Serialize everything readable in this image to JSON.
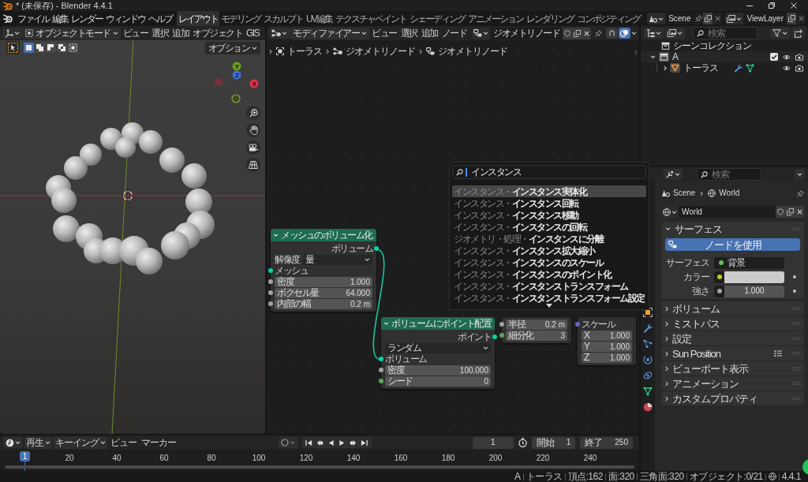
{
  "title_bar": {
    "title": "* (未保存) - Blender 4.4.1"
  },
  "top_bar": {
    "menus": [
      "ファイル",
      "編集",
      "レンダー",
      "ウィンドウ",
      "ヘルプ"
    ],
    "workspaces": [
      {
        "label": "レイアウト",
        "selected": true
      },
      {
        "label": "モデリング",
        "selected": false
      },
      {
        "label": "スカルプト",
        "selected": false
      },
      {
        "label": "UV編集",
        "selected": false
      },
      {
        "label": "テクスチャペイント",
        "selected": false
      },
      {
        "label": "シェーディング",
        "selected": false
      },
      {
        "label": "アニメーション",
        "selected": false
      },
      {
        "label": "レンダリング",
        "selected": false
      },
      {
        "label": "コンポジティング",
        "selected": false
      }
    ],
    "scene": "Scene",
    "view_layer": "ViewLayer"
  },
  "viewport": {
    "mode": "オブジェクトモード",
    "menus": [
      "ビュー",
      "選択",
      "追加",
      "オブジェクト",
      "GIS"
    ],
    "select_modes": [
      {
        "selected": true
      },
      {
        "selected": false
      },
      {
        "selected": false
      },
      {
        "selected": false
      },
      {
        "selected": false
      }
    ],
    "options": "オプション",
    "gizmo": {
      "y": "Y",
      "z": "Z",
      "x": "X"
    }
  },
  "node_editor": {
    "context": "モディファイアー",
    "menus": [
      "ビュー",
      "選択",
      "追加",
      "ノード"
    ],
    "node_group": "ジオメトリノード",
    "snapping": false,
    "overlays": true,
    "breadcrumbs": [
      {
        "kind": "object",
        "label": "トーラス"
      },
      {
        "kind": "modifier",
        "label": "ジオメトリノード"
      },
      {
        "kind": "group",
        "label": "ジオメトリノード"
      }
    ],
    "nodes": [
      {
        "title": "メッシュのボリューム化",
        "rows": [
          {
            "kind": "output",
            "label": "ボリューム",
            "color": "#00d6a3"
          },
          {
            "kind": "select",
            "label": "解像度",
            "value": "量"
          },
          {
            "kind": "socket",
            "label": "メッシュ",
            "color": "#00d6a3"
          },
          {
            "kind": "field",
            "label": "密度",
            "value": "1.000",
            "color": "#a1a1a1"
          },
          {
            "kind": "field",
            "label": "ボクセル量",
            "value": "64.000",
            "color": "#a1a1a1"
          },
          {
            "kind": "field",
            "label": "内部の幅",
            "value": "0.2 m",
            "color": "#a1a1a1"
          }
        ]
      },
      {
        "title": "ボリュームにポイント配置",
        "rows": [
          {
            "kind": "output",
            "label": "ポイント",
            "color": "#00d6a3"
          },
          {
            "kind": "select",
            "value": "ランダム"
          },
          {
            "kind": "socket",
            "label": "ボリューム",
            "color": "#00d6a3"
          },
          {
            "kind": "field",
            "label": "密度",
            "value": "100.000",
            "color": "#a1a1a1"
          },
          {
            "kind": "field",
            "label": "シード",
            "value": "0",
            "color": "#5aa85a"
          }
        ]
      },
      {
        "rows": [
          {
            "kind": "field",
            "label": "半径",
            "value": "0.2 m",
            "color": "#a1a1a1"
          },
          {
            "kind": "field",
            "label": "細分化",
            "value": "3",
            "color": "#5aa85a"
          }
        ]
      },
      {
        "rows": [
          {
            "kind": "socket",
            "label": "スケール",
            "color": "#6363c7"
          },
          {
            "kind": "field",
            "label": "X",
            "value": "1.000"
          },
          {
            "kind": "field",
            "label": "Y",
            "value": "1.000"
          },
          {
            "kind": "field",
            "label": "Z",
            "value": "1.000"
          }
        ]
      }
    ],
    "search": {
      "value": "インスタンス",
      "results": [
        {
          "path": "インスタンス・",
          "name": "インスタンス実体化",
          "selected": true
        },
        {
          "path": "インスタンス・",
          "name": "インスタンス回転",
          "selected": false
        },
        {
          "path": "インスタンス・",
          "name": "インスタンス移動",
          "selected": false
        },
        {
          "path": "インスタンス・",
          "name": "インスタンスの回転",
          "selected": false
        },
        {
          "path": "ジオメトリ・処理・",
          "name": "インスタンスに分離",
          "selected": false
        },
        {
          "path": "インスタンス・",
          "name": "インスタンス拡大縮小",
          "selected": false
        },
        {
          "path": "インスタンス・",
          "name": "インスタンスのスケール",
          "selected": false
        },
        {
          "path": "インスタンス・",
          "name": "インスタンスのポイント化",
          "selected": false
        },
        {
          "path": "インスタンス・",
          "name": "インスタンストランスフォーム",
          "selected": false
        },
        {
          "path": "インスタンス・",
          "name": "インスタンストランスフォーム設定",
          "selected": false
        }
      ]
    }
  },
  "outliner": {
    "search": {
      "placeholder": "検索"
    },
    "tree": [
      {
        "kind": "scene",
        "label": "シーンコレクション",
        "children": [
          {
            "kind": "collection",
            "label": "A",
            "expanded": true,
            "checked": true,
            "children": [
              {
                "kind": "mesh",
                "label": "トーラス",
                "expanded": false
              }
            ]
          }
        ]
      }
    ]
  },
  "properties": {
    "search": {
      "placeholder": "検索"
    },
    "breadcrumbs": [
      {
        "kind": "scene",
        "label": "Scene"
      },
      {
        "kind": "world",
        "label": "World"
      }
    ],
    "world": "World",
    "panels": [
      {
        "kind": "section",
        "title": "サーフェス",
        "expanded": true,
        "button": "ノードを使用",
        "rows": [
          {
            "kind": "link",
            "label": "サーフェス",
            "value": "背景",
            "color": "#5ec45e"
          },
          {
            "kind": "color",
            "label": "カラー",
            "color": "#c7c729",
            "value": {
              "color": "#cccccc"
            }
          },
          {
            "kind": "number",
            "label": "強さ",
            "value": "1.000",
            "color": "#a1a1a1"
          }
        ]
      },
      {
        "kind": "section",
        "title": "ボリューム",
        "expanded": false
      },
      {
        "kind": "section",
        "title": "ミストパス",
        "expanded": false
      },
      {
        "kind": "section",
        "title": "設定",
        "expanded": false
      },
      {
        "kind": "addon",
        "title": "Sun Position",
        "expanded": false
      },
      {
        "kind": "section",
        "title": "ビューポート表示",
        "expanded": false
      },
      {
        "kind": "section",
        "title": "アニメーション",
        "expanded": false
      },
      {
        "kind": "section",
        "title": "カスタムプロパティ",
        "expanded": false
      }
    ]
  },
  "timeline": {
    "menus": [
      {
        "label": "再生",
        "dropdown": true
      },
      {
        "label": "キーイング",
        "dropdown": true
      },
      {
        "label": "ビュー",
        "dropdown": false
      },
      {
        "label": "マーカー",
        "dropdown": false
      }
    ],
    "auto_keying": false,
    "current_frame": "1",
    "start_label": "開始",
    "start": "1",
    "end_label": "終了",
    "end": "250",
    "playhead": "1",
    "ruler": [
      "20",
      "40",
      "60",
      "80",
      "100",
      "120",
      "140",
      "160",
      "180",
      "200",
      "220",
      "240"
    ]
  },
  "status_bar": {
    "items": [
      "A",
      "トーラス",
      "頂点:162",
      "面:320",
      "三角面:320",
      "オブジェクト:0/21"
    ],
    "version": "4.4.1"
  }
}
